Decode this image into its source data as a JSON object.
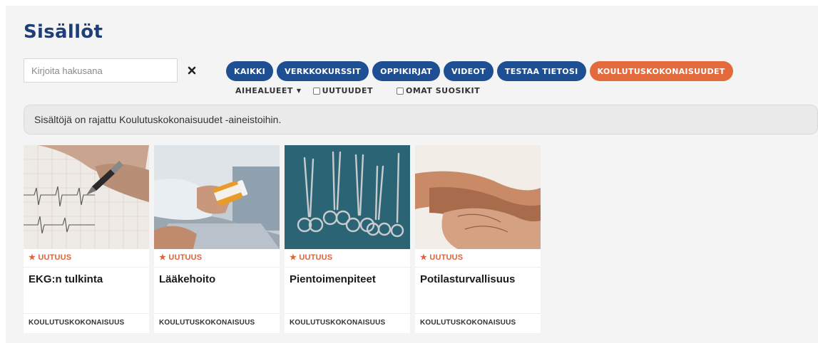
{
  "page": {
    "title": "Sisällöt"
  },
  "search": {
    "placeholder": "Kirjoita hakusana",
    "value": "",
    "clear_icon": "close-icon"
  },
  "filters": [
    {
      "label": "KAIKKI",
      "active": false
    },
    {
      "label": "VERKKOKURSSIT",
      "active": false
    },
    {
      "label": "OPPIKIRJAT",
      "active": false
    },
    {
      "label": "VIDEOT",
      "active": false
    },
    {
      "label": "TESTAA TIETOSI",
      "active": false
    },
    {
      "label": "KOULUTUSKOKONAISUUDET",
      "active": true
    }
  ],
  "options": {
    "topics_label": "AIHEALUEET",
    "news_label": "UUTUUDET",
    "news_checked": false,
    "favorites_label": "OMAT SUOSIKIT",
    "favorites_checked": false
  },
  "info": {
    "text": "Sisältöjä on rajattu Koulutuskokonaisuudet -aineistoihin."
  },
  "cards": [
    {
      "badge": "★ UUTUUS",
      "title": "EKG:n tulkinta",
      "type": "KOULUTUSKOKONAISUUS",
      "image": "ecg-chart-writing"
    },
    {
      "badge": "★ UUTUUS",
      "title": "Lääkehoito",
      "type": "KOULUTUSKOKONAISUUS",
      "image": "pill-bottle-laptop"
    },
    {
      "badge": "★ UUTUUS",
      "title": "Pientoimenpiteet",
      "type": "KOULUTUSKOKONAISUUS",
      "image": "surgical-instruments"
    },
    {
      "badge": "★ UUTUUS",
      "title": "Potilasturvallisuus",
      "type": "KOULUTUSKOKONAISUUS",
      "image": "holding-hands"
    }
  ],
  "colors": {
    "brand": "#1f3e78",
    "button": "#1f4f93",
    "active": "#e26a3c",
    "badge": "#e0633a"
  }
}
